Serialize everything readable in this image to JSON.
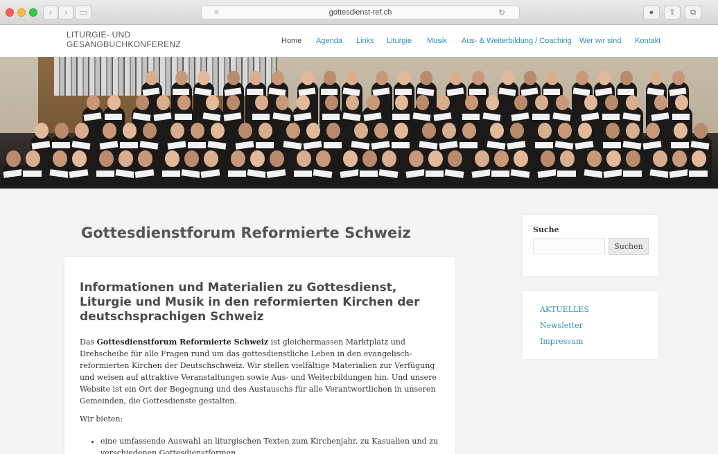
{
  "browser": {
    "url": "gottesdienst-ref.ch"
  },
  "site": {
    "logo_line1": "LITURGIE- UND",
    "logo_line2": "GESANGBUCHKONFERENZ"
  },
  "nav": {
    "items": [
      {
        "label": "Home"
      },
      {
        "label": "Agenda"
      },
      {
        "label": "Links"
      },
      {
        "label": "Liturgie"
      },
      {
        "label": "Musik"
      },
      {
        "label": "Aus- & Weiterbildung / Coaching"
      },
      {
        "label": "Wer wir sind"
      },
      {
        "label": "Kontakt"
      }
    ]
  },
  "page": {
    "title": "Gottesdienstforum Reformierte Schweiz"
  },
  "article": {
    "heading": "Informationen und Materialien zu Gottesdienst, Liturgie und Musik in den reformierten Kirchen der deutschsprachigen Schweiz",
    "intro_bold": "Gottesdienstforum Reformierte Schweiz",
    "intro_pre": "Das ",
    "intro_post": " ist gleichermassen Marktplatz und Drehscheibe für alle Fragen rund um das gottesdienstliche Leben in den evangelisch-reformierten Kirchen der Deutschschweiz. Wir stellen vielfältige Materialien zur Verfügung und weisen auf attraktive Veranstaltungen sowie Aus- und Weiterbildungen hin. Und unsere Website ist ein Ort der Begegnung und des Austauschs für alle Verantwortlichen in unseren Gemeinden, die Gottesdienste gestalten.",
    "offer_label": "Wir bieten:",
    "offer_items": [
      "eine umfassende Auswahl an liturgischen Texten zum Kirchenjahr, zu Kasualien und zu verschiedenen Gottesdienstformen"
    ]
  },
  "sidebar": {
    "search_title": "Suche",
    "search_value": "",
    "search_button": "Suchen",
    "links": [
      {
        "label": "AKTUELLES"
      },
      {
        "label": "Newsletter"
      },
      {
        "label": "Impressum"
      }
    ]
  }
}
